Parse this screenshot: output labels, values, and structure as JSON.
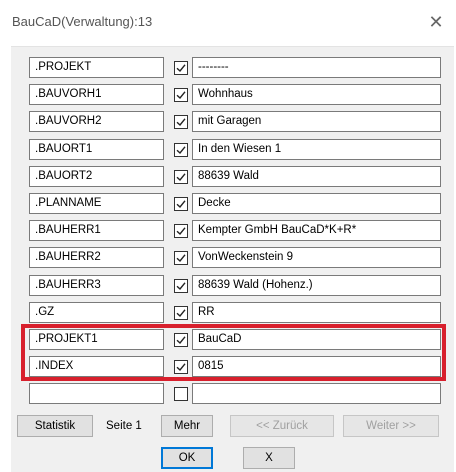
{
  "window": {
    "title": "BauCaD(Verwaltung):13",
    "close_glyph": "✕"
  },
  "rows": [
    {
      "key": ".PROJEKT",
      "checked": true,
      "value": "--------"
    },
    {
      "key": ".BAUVORH1",
      "checked": true,
      "value": "Wohnhaus"
    },
    {
      "key": ".BAUVORH2",
      "checked": true,
      "value": "mit Garagen"
    },
    {
      "key": ".BAUORT1",
      "checked": true,
      "value": "In den Wiesen 1"
    },
    {
      "key": ".BAUORT2",
      "checked": true,
      "value": "88639 Wald"
    },
    {
      "key": ".PLANNAME",
      "checked": true,
      "value": "Decke"
    },
    {
      "key": ".BAUHERR1",
      "checked": true,
      "value": "Kempter GmbH BauCaD*K+R*"
    },
    {
      "key": ".BAUHERR2",
      "checked": true,
      "value": "VonWeckenstein 9"
    },
    {
      "key": ".BAUHERR3",
      "checked": true,
      "value": "88639 Wald (Hohenz.)"
    },
    {
      "key": ".GZ",
      "checked": true,
      "value": "RR"
    },
    {
      "key": ".PROJEKT1",
      "checked": true,
      "value": "BauCaD"
    },
    {
      "key": ".INDEX",
      "checked": true,
      "value": "0815"
    },
    {
      "key": "",
      "checked": false,
      "value": ""
    }
  ],
  "buttons": {
    "statistik": "Statistik",
    "page_label": "Seite 1",
    "mehr": "Mehr",
    "zurueck": "<< Zurück",
    "weiter": "Weiter >>",
    "ok": "OK",
    "cancel": "X"
  },
  "colors": {
    "highlight": "#d8202d",
    "default_button_border": "#0078d7"
  },
  "icons": {
    "close": "close-icon",
    "check": "checkmark-icon"
  }
}
